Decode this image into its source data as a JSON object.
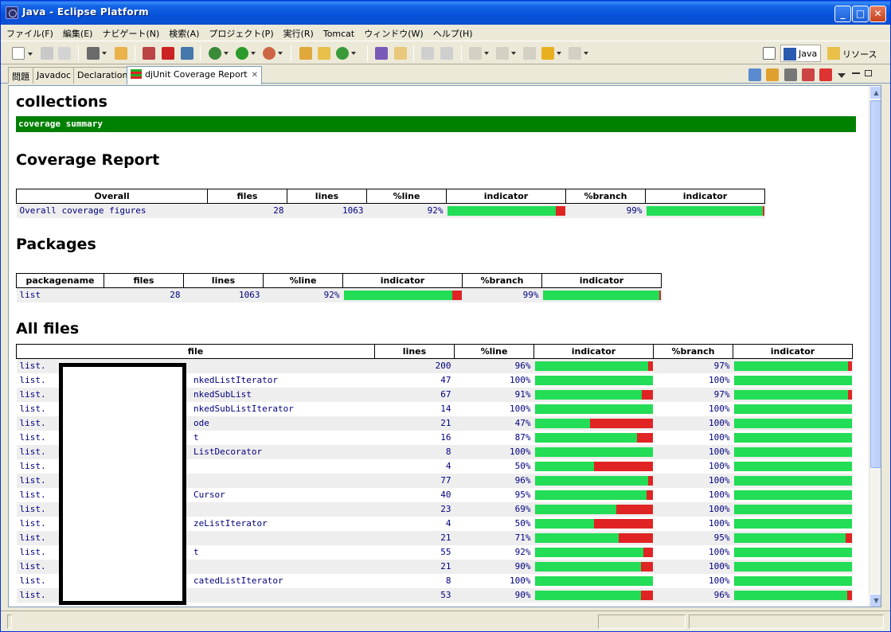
{
  "window": {
    "title": "Java - Eclipse Platform"
  },
  "menu": [
    "ファイル(F)",
    "編集(E)",
    "ナビゲート(N)",
    "検索(A)",
    "プロジェクト(P)",
    "実行(R)",
    "Tomcat",
    "ウィンドウ(W)",
    "ヘルプ(H)"
  ],
  "perspectives": {
    "java": "Java",
    "resource": "リソース"
  },
  "tabs": [
    {
      "label": "問題"
    },
    {
      "label": "Javadoc"
    },
    {
      "label": "Declaration"
    },
    {
      "label": "djUnit Coverage Report"
    }
  ],
  "colors": {
    "covered": "#22dd55",
    "uncovered": "#e02424",
    "header_bar": "#008000"
  },
  "report": {
    "title": "collections",
    "summary_bar": "coverage summary",
    "coverage_heading": "Coverage Report",
    "overall_headers": [
      "Overall",
      "files",
      "lines",
      "%line",
      "indicator",
      "%branch",
      "indicator"
    ],
    "overall": {
      "name": "Overall coverage figures",
      "files": "28",
      "lines": "1063",
      "line_pct": "92%",
      "branch_pct": "99%",
      "line_ratio": 0.92,
      "branch_ratio": 0.99
    },
    "packages_heading": "Packages",
    "package_headers": [
      "packagename",
      "files",
      "lines",
      "%line",
      "indicator",
      "%branch",
      "indicator"
    ],
    "packages": [
      {
        "name": "list",
        "files": "28",
        "lines": "1063",
        "line_pct": "92%",
        "branch_pct": "99%",
        "line_ratio": 0.92,
        "branch_ratio": 0.99
      }
    ],
    "files_heading": "All files",
    "file_headers": [
      "file",
      "lines",
      "%line",
      "indicator",
      "%branch",
      "indicator"
    ],
    "files": [
      {
        "prefix": "list.",
        "suffix": "",
        "lines": "200",
        "line_pct": "96%",
        "branch_pct": "97%",
        "line_ratio": 0.96,
        "branch_ratio": 0.97
      },
      {
        "prefix": "list.",
        "suffix": "nkedListIterator",
        "lines": "47",
        "line_pct": "100%",
        "branch_pct": "100%",
        "line_ratio": 1.0,
        "branch_ratio": 1.0
      },
      {
        "prefix": "list.",
        "suffix": "nkedSubList",
        "lines": "67",
        "line_pct": "91%",
        "branch_pct": "97%",
        "line_ratio": 0.91,
        "branch_ratio": 0.97
      },
      {
        "prefix": "list.",
        "suffix": "nkedSubListIterator",
        "lines": "14",
        "line_pct": "100%",
        "branch_pct": "100%",
        "line_ratio": 1.0,
        "branch_ratio": 1.0
      },
      {
        "prefix": "list.",
        "suffix": "ode",
        "lines": "21",
        "line_pct": "47%",
        "branch_pct": "100%",
        "line_ratio": 0.47,
        "branch_ratio": 1.0
      },
      {
        "prefix": "list.",
        "suffix": "t",
        "lines": "16",
        "line_pct": "87%",
        "branch_pct": "100%",
        "line_ratio": 0.87,
        "branch_ratio": 1.0
      },
      {
        "prefix": "list.",
        "suffix": "ListDecorator",
        "lines": "8",
        "line_pct": "100%",
        "branch_pct": "100%",
        "line_ratio": 1.0,
        "branch_ratio": 1.0
      },
      {
        "prefix": "list.",
        "suffix": "",
        "lines": "4",
        "line_pct": "50%",
        "branch_pct": "100%",
        "line_ratio": 0.5,
        "branch_ratio": 1.0
      },
      {
        "prefix": "list.",
        "suffix": "",
        "lines": "77",
        "line_pct": "96%",
        "branch_pct": "100%",
        "line_ratio": 0.96,
        "branch_ratio": 1.0
      },
      {
        "prefix": "list.",
        "suffix": "Cursor",
        "lines": "40",
        "line_pct": "95%",
        "branch_pct": "100%",
        "line_ratio": 0.95,
        "branch_ratio": 1.0
      },
      {
        "prefix": "list.",
        "suffix": "",
        "lines": "23",
        "line_pct": "69%",
        "branch_pct": "100%",
        "line_ratio": 0.69,
        "branch_ratio": 1.0
      },
      {
        "prefix": "list.",
        "suffix": "zeListIterator",
        "lines": "4",
        "line_pct": "50%",
        "branch_pct": "100%",
        "line_ratio": 0.5,
        "branch_ratio": 1.0
      },
      {
        "prefix": "list.",
        "suffix": "",
        "lines": "21",
        "line_pct": "71%",
        "branch_pct": "95%",
        "line_ratio": 0.71,
        "branch_ratio": 0.95
      },
      {
        "prefix": "list.",
        "suffix": "t",
        "lines": "55",
        "line_pct": "92%",
        "branch_pct": "100%",
        "line_ratio": 0.92,
        "branch_ratio": 1.0
      },
      {
        "prefix": "list.",
        "suffix": "",
        "lines": "21",
        "line_pct": "90%",
        "branch_pct": "100%",
        "line_ratio": 0.9,
        "branch_ratio": 1.0
      },
      {
        "prefix": "list.",
        "suffix": "catedListIterator",
        "lines": "8",
        "line_pct": "100%",
        "branch_pct": "100%",
        "line_ratio": 1.0,
        "branch_ratio": 1.0
      },
      {
        "prefix": "list.",
        "suffix": "",
        "lines": "53",
        "line_pct": "90%",
        "branch_pct": "96%",
        "line_ratio": 0.9,
        "branch_ratio": 0.96
      }
    ]
  }
}
